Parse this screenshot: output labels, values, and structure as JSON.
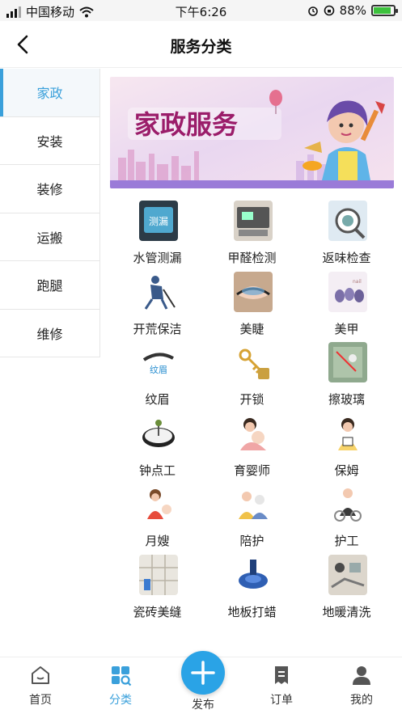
{
  "status_bar": {
    "carrier": "中国移动",
    "time": "下午6:26",
    "battery": "88%",
    "battery_level": 0.88
  },
  "header": {
    "title": "服务分类",
    "back_icon": "chevron-left-icon"
  },
  "sidebar": {
    "items": [
      {
        "label": "家政",
        "active": true
      },
      {
        "label": "安装",
        "active": false
      },
      {
        "label": "装修",
        "active": false
      },
      {
        "label": "运搬",
        "active": false
      },
      {
        "label": "跑腿",
        "active": false
      },
      {
        "label": "维修",
        "active": false
      }
    ]
  },
  "banner": {
    "title": "家政服务"
  },
  "services": [
    {
      "label": "水管测漏",
      "thumb_text": "测漏"
    },
    {
      "label": "甲醛检测"
    },
    {
      "label": "返味检查"
    },
    {
      "label": "开荒保洁"
    },
    {
      "label": "美睫"
    },
    {
      "label": "美甲"
    },
    {
      "label": "纹眉",
      "thumb_text": "纹眉"
    },
    {
      "label": "开锁"
    },
    {
      "label": "擦玻璃"
    },
    {
      "label": "钟点工"
    },
    {
      "label": "育婴师"
    },
    {
      "label": "保姆"
    },
    {
      "label": "月嫂"
    },
    {
      "label": "陪护"
    },
    {
      "label": "护工"
    },
    {
      "label": "瓷砖美缝"
    },
    {
      "label": "地板打蜡"
    },
    {
      "label": "地暖清洗"
    }
  ],
  "tabbar": {
    "items": [
      {
        "label": "首页",
        "icon": "home-icon",
        "active": false
      },
      {
        "label": "分类",
        "icon": "category-icon",
        "active": true
      },
      {
        "label": "发布",
        "icon": "plus-icon",
        "active": false
      },
      {
        "label": "订单",
        "icon": "order-icon",
        "active": false
      },
      {
        "label": "我的",
        "icon": "profile-icon",
        "active": false
      }
    ]
  },
  "colors": {
    "accent": "#3aa0db",
    "fab": "#2aa3e6"
  }
}
